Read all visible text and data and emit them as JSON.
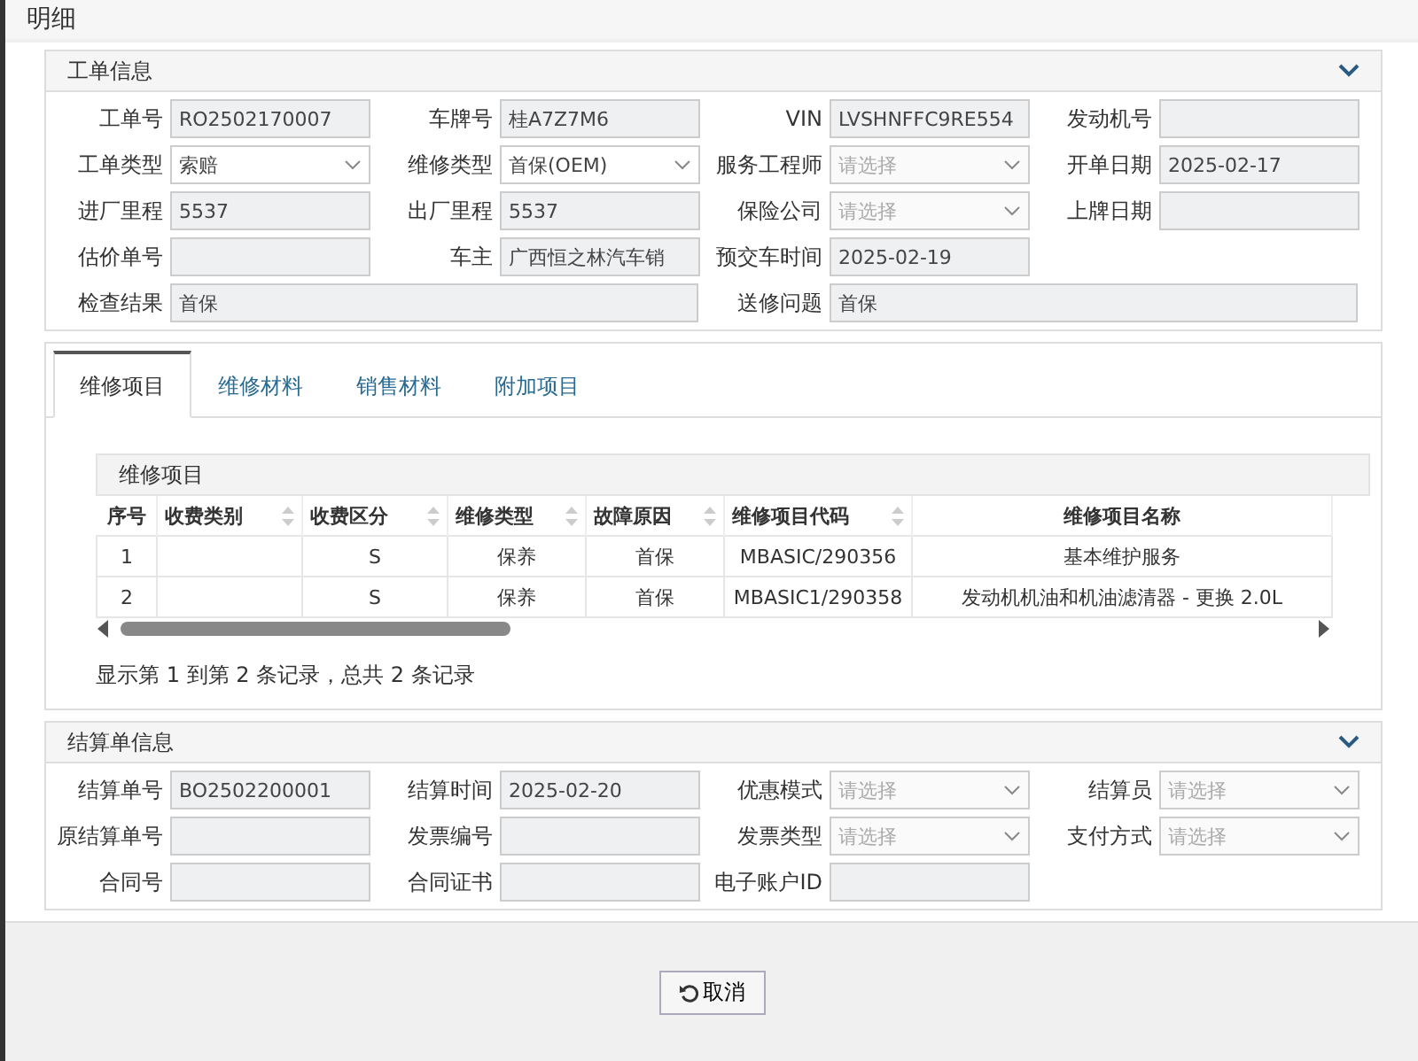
{
  "window": {
    "title": "明细"
  },
  "work_order": {
    "title": "工单信息",
    "expanded": true,
    "rows": [
      [
        {
          "label": "工单号",
          "kind": "text",
          "value": "RO2502170007"
        },
        {
          "label": "车牌号",
          "kind": "text",
          "value": "桂A7Z7M6"
        },
        {
          "label": "VIN",
          "kind": "text",
          "value": "LVSHNFFC9RE554"
        },
        {
          "label": "发动机号",
          "kind": "text"
        }
      ],
      [
        {
          "label": "工单类型",
          "kind": "select",
          "value": "索赔"
        },
        {
          "label": "维修类型",
          "kind": "select",
          "value": "首保(OEM)"
        },
        {
          "label": "服务工程师",
          "kind": "select",
          "placeholder": "请选择"
        },
        {
          "label": "开单日期",
          "kind": "text",
          "value": "2025-02-17"
        }
      ],
      [
        {
          "label": "进厂里程",
          "kind": "text",
          "value": "5537"
        },
        {
          "label": "出厂里程",
          "kind": "text",
          "value": "5537"
        },
        {
          "label": "保险公司",
          "kind": "select",
          "placeholder": "请选择"
        },
        {
          "label": "上牌日期",
          "kind": "text"
        }
      ],
      [
        {
          "label": "估价单号",
          "kind": "text"
        },
        {
          "label": "车主",
          "kind": "text",
          "value": "广西恒之林汽车销"
        },
        {
          "label": "预交车时间",
          "kind": "text",
          "value": "2025-02-19"
        }
      ],
      [
        {
          "label": "检查结果",
          "kind": "wide",
          "value": "首保"
        },
        "",
        {
          "label": "送修问题",
          "kind": "wide",
          "value": "首保"
        },
        ""
      ]
    ]
  },
  "tabs": [
    {
      "label": "维修项目",
      "selected": true
    },
    {
      "label": "维修材料",
      "selected": false
    },
    {
      "label": "销售材料",
      "selected": false
    },
    {
      "label": "附加项目",
      "selected": false
    }
  ],
  "table": {
    "title": "维修项目",
    "columns": [
      {
        "label": "序号",
        "sortable": false
      },
      {
        "label": "收费类别",
        "sortable": true
      },
      {
        "label": "收费区分",
        "sortable": true
      },
      {
        "label": "维修类型",
        "sortable": true
      },
      {
        "label": "故障原因",
        "sortable": true
      },
      {
        "label": "维修项目代码",
        "sortable": true
      },
      {
        "label": "维修项目名称",
        "sortable": false
      }
    ],
    "rows": [
      [
        "1",
        "",
        "S",
        "保养",
        "首保",
        "MBASIC/290356",
        "基本维护服务"
      ],
      [
        "2",
        "",
        "S",
        "保养",
        "首保",
        "MBASIC1/290358",
        "发动机机油和机油滤清器 - 更换 2.0L"
      ]
    ],
    "footer": "显示第 1 到第 2 条记录，总共 2 条记录"
  },
  "settlement": {
    "title": "结算单信息",
    "expanded": true,
    "rows": [
      [
        {
          "label": "结算单号",
          "kind": "text",
          "value": "BO2502200001"
        },
        {
          "label": "结算时间",
          "kind": "text",
          "value": "2025-02-20"
        },
        {
          "label": "优惠模式",
          "kind": "select",
          "placeholder": "请选择"
        },
        {
          "label": "结算员",
          "kind": "select",
          "placeholder": "请选择"
        }
      ],
      [
        {
          "label": "原结算单号",
          "kind": "text"
        },
        {
          "label": "发票编号",
          "kind": "text"
        },
        {
          "label": "发票类型",
          "kind": "select",
          "placeholder": "请选择"
        },
        {
          "label": "支付方式",
          "kind": "select",
          "placeholder": "请选择"
        }
      ],
      [
        {
          "label": "合同号",
          "kind": "text"
        },
        {
          "label": "合同证书",
          "kind": "text"
        },
        {
          "label": "电子账户ID",
          "kind": "text"
        }
      ]
    ]
  },
  "buttons": [
    {
      "label": "取消"
    }
  ]
}
